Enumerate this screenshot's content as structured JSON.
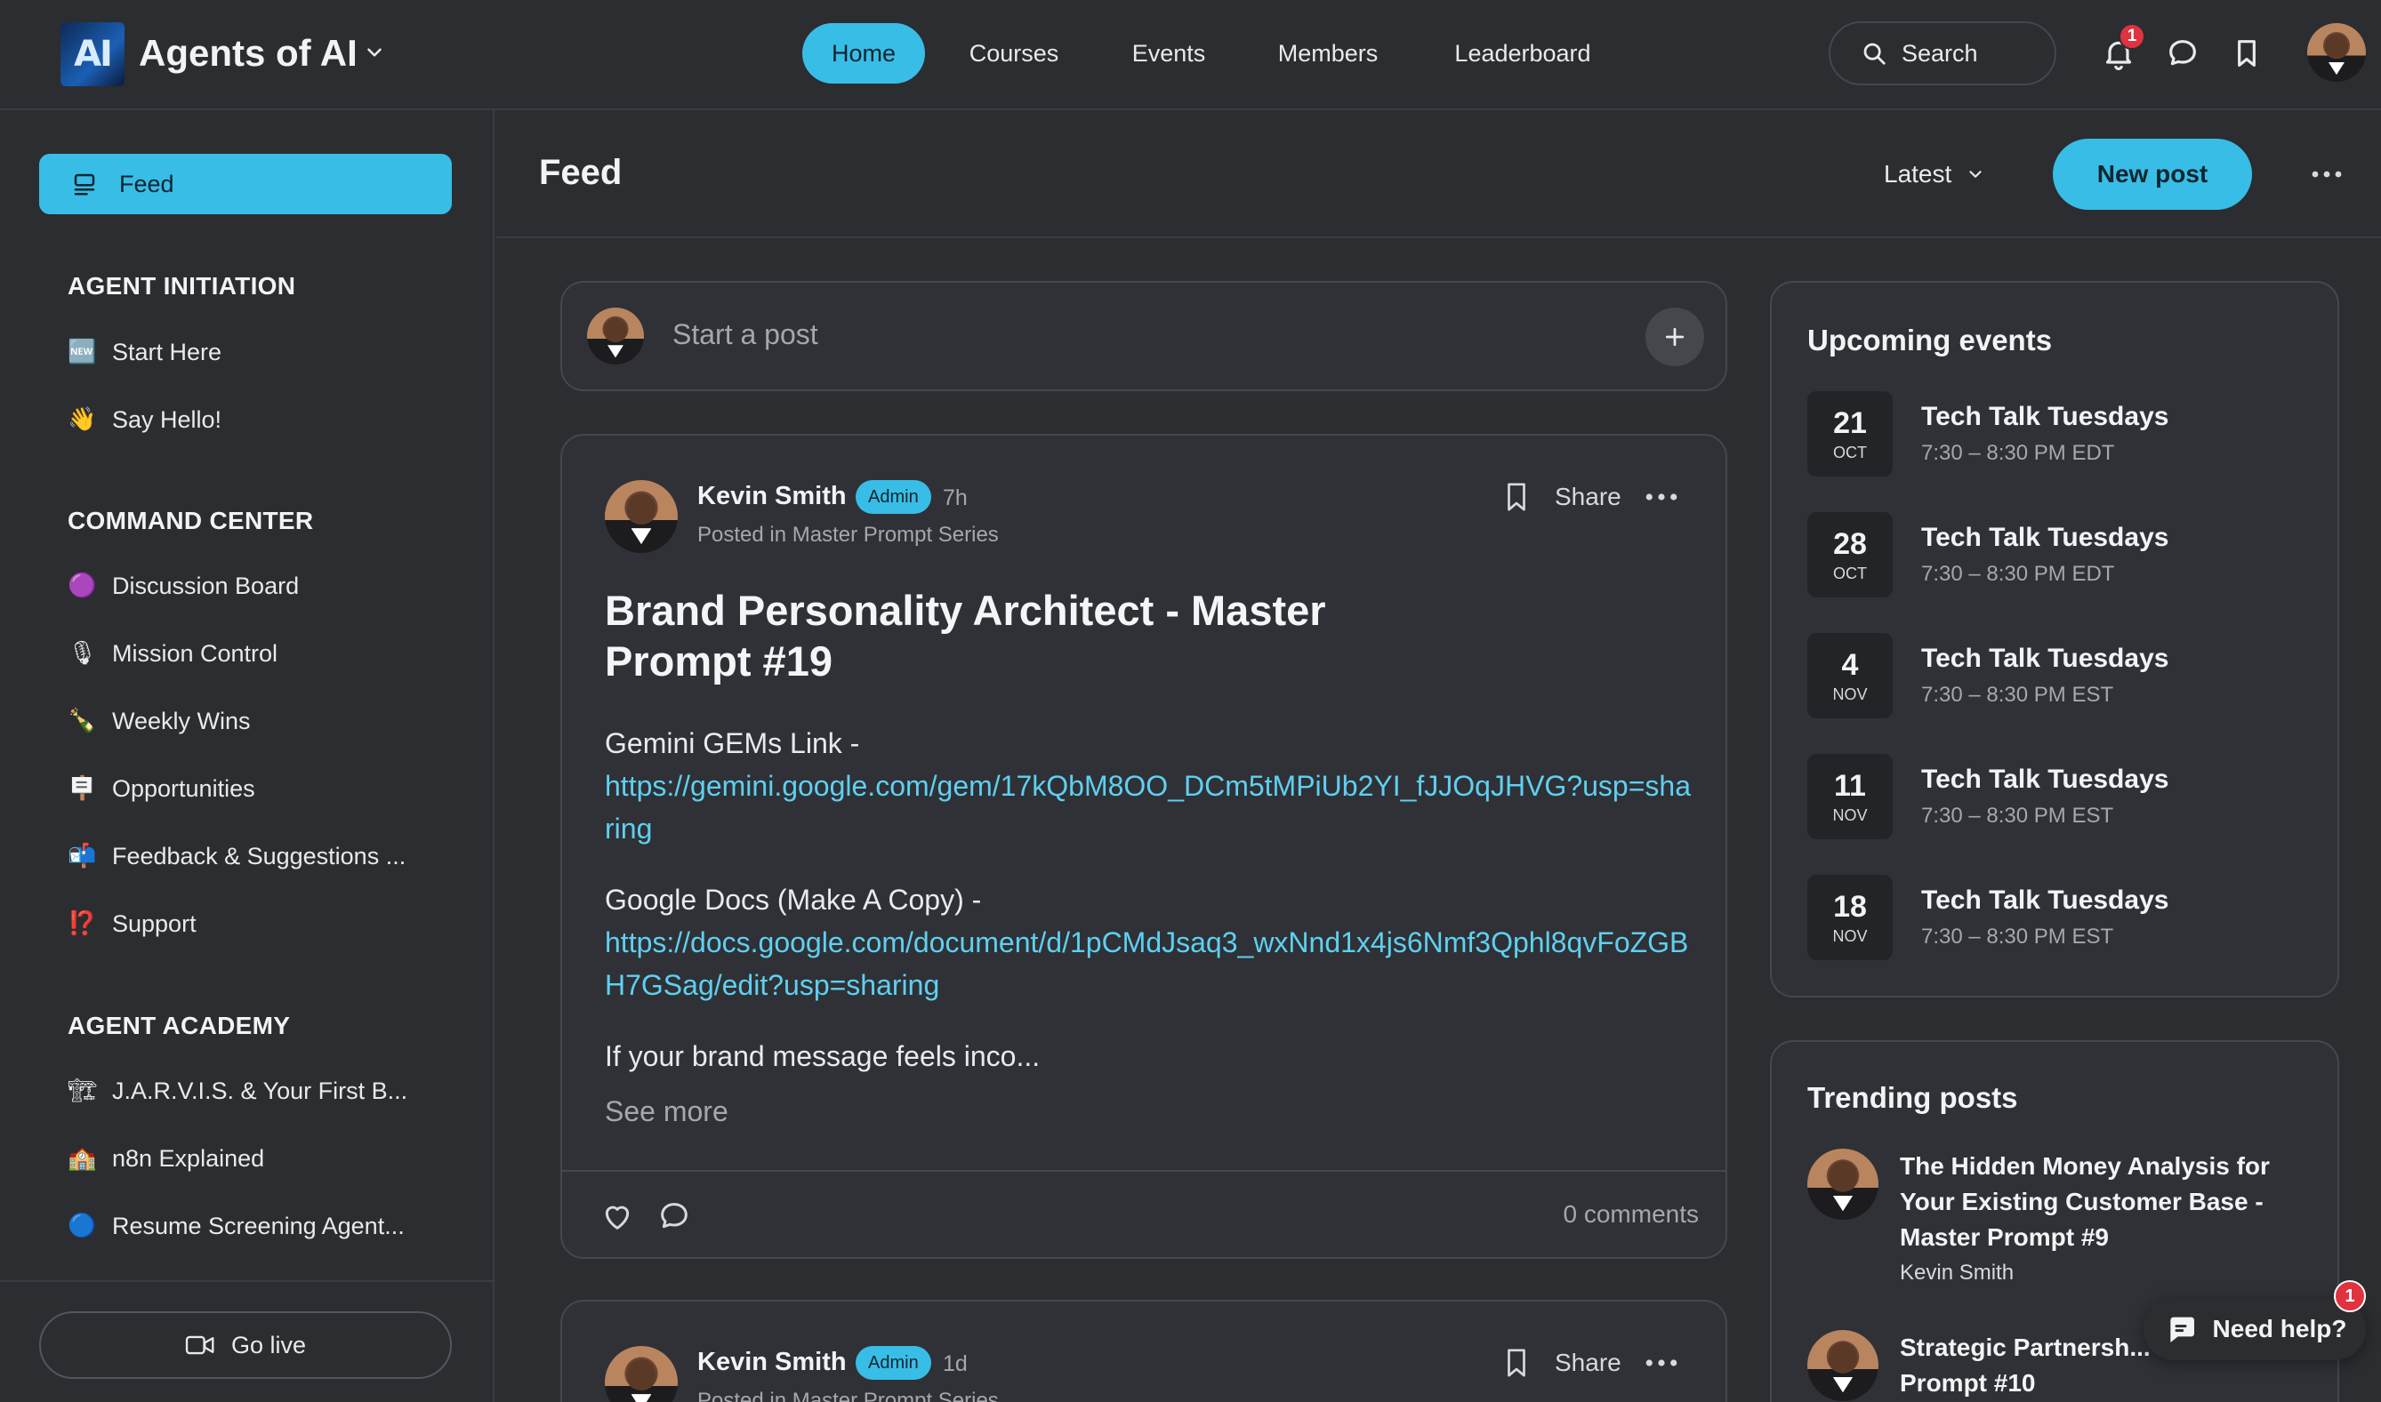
{
  "header": {
    "app_name": "Agents of AI",
    "logo_text": "AI",
    "nav": [
      {
        "label": "Home",
        "active": true
      },
      {
        "label": "Courses",
        "active": false
      },
      {
        "label": "Events",
        "active": false
      },
      {
        "label": "Members",
        "active": false
      },
      {
        "label": "Leaderboard",
        "active": false
      }
    ],
    "search_label": "Search",
    "notification_count": "1",
    "icons": [
      "search-icon",
      "bell-icon",
      "chat-icon",
      "bookmark-icon",
      "avatar"
    ]
  },
  "sidebar": {
    "feed_label": "Feed",
    "sections": [
      {
        "title": "AGENT INITIATION",
        "items": [
          {
            "emoji": "🆕",
            "label": "Start Here"
          },
          {
            "emoji": "👋",
            "label": "Say Hello!"
          }
        ]
      },
      {
        "title": "COMMAND CENTER",
        "items": [
          {
            "emoji": "🟣",
            "label": "Discussion Board"
          },
          {
            "emoji": "🎙",
            "label": "Mission Control"
          },
          {
            "emoji": "🍾",
            "label": "Weekly Wins"
          },
          {
            "emoji": "🪧",
            "label": "Opportunities"
          },
          {
            "emoji": "📬",
            "label": "Feedback & Suggestions ..."
          },
          {
            "emoji": "⁉️",
            "label": "Support"
          }
        ]
      },
      {
        "title": "AGENT ACADEMY",
        "items": [
          {
            "emoji": "🏗",
            "label": "J.A.R.V.I.S. & Your First B..."
          },
          {
            "emoji": "🏫",
            "label": "n8n Explained"
          },
          {
            "emoji": "🔵",
            "label": "Resume Screening Agent..."
          }
        ]
      }
    ],
    "go_live_label": "Go live"
  },
  "feed": {
    "title": "Feed",
    "sort_label": "Latest",
    "new_post_label": "New post",
    "composer_placeholder": "Start a post"
  },
  "posts": [
    {
      "author": "Kevin Smith",
      "badge": "Admin",
      "time": "7h",
      "posted_in": "Posted in Master Prompt Series",
      "share_label": "Share",
      "title": "Brand Personality Architect - Master Prompt #19",
      "body_1_label": "Gemini GEMs Link -",
      "body_1_link": "https://gemini.google.com/gem/17kQbM8OO_DCm5tMPiUb2YI_fJJOqJHVG?usp=sharing",
      "body_2_label": "Google Docs (Make A Copy) -",
      "body_2_link": "https://docs.google.com/document/d/1pCMdJsaq3_wxNnd1x4js6Nmf3Qphl8qvFoZGBH7GSag/edit?usp=sharing",
      "body_3": "If your brand message feels inco...",
      "see_more": "See more",
      "comments": "0 comments"
    },
    {
      "author": "Kevin Smith",
      "badge": "Admin",
      "time": "1d",
      "posted_in": "Posted in Master Prompt Series",
      "share_label": "Share"
    }
  ],
  "upcoming_events": {
    "title": "Upcoming events",
    "items": [
      {
        "day": "21",
        "month": "OCT",
        "name": "Tech Talk Tuesdays",
        "time": "7:30 – 8:30 PM EDT"
      },
      {
        "day": "28",
        "month": "OCT",
        "name": "Tech Talk Tuesdays",
        "time": "7:30 – 8:30 PM EDT"
      },
      {
        "day": "4",
        "month": "NOV",
        "name": "Tech Talk Tuesdays",
        "time": "7:30 – 8:30 PM EST"
      },
      {
        "day": "11",
        "month": "NOV",
        "name": "Tech Talk Tuesdays",
        "time": "7:30 – 8:30 PM EST"
      },
      {
        "day": "18",
        "month": "NOV",
        "name": "Tech Talk Tuesdays",
        "time": "7:30 – 8:30 PM EST"
      }
    ]
  },
  "trending": {
    "title": "Trending posts",
    "items": [
      {
        "title": "The Hidden Money Analysis for Your Existing Customer Base - Master Prompt #9",
        "author": "Kevin Smith"
      },
      {
        "title": "Strategic Partnersh... The Master Prompt #10",
        "author": ""
      }
    ]
  },
  "help": {
    "label": "Need help?",
    "badge": "1"
  },
  "colors": {
    "accent": "#38bde6",
    "background": "#2b2d31",
    "card": "#2f3136",
    "link": "#5fd0f0",
    "badge": "#e0323f"
  }
}
